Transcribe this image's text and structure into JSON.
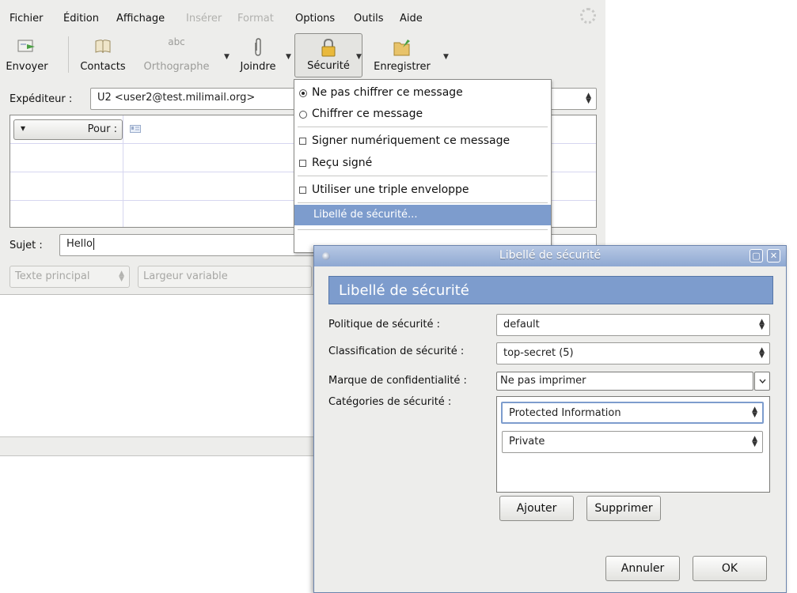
{
  "menubar": {
    "items": [
      {
        "label": "Fichier",
        "disabled": false
      },
      {
        "label": "Édition",
        "disabled": false
      },
      {
        "label": "Affichage",
        "disabled": false
      },
      {
        "label": "Insérer",
        "disabled": true
      },
      {
        "label": "Format",
        "disabled": true
      },
      {
        "label": "Options",
        "disabled": false
      },
      {
        "label": "Outils",
        "disabled": false
      },
      {
        "label": "Aide",
        "disabled": false
      }
    ]
  },
  "toolbar": {
    "send": "Envoyer",
    "contacts": "Contacts",
    "spelling": "Orthographe",
    "spelling_icon_text": "abc",
    "attach": "Joindre",
    "security": "Sécurité",
    "save": "Enregistrer"
  },
  "compose": {
    "sender_label": "Expéditeur :",
    "sender_value": "U2 <user2@test.milimail.org>",
    "to_label": "Pour :",
    "subject_label": "Sujet :",
    "subject_value": "Hello",
    "format_select": "Texte principal",
    "width_select": "Largeur variable"
  },
  "security_menu": {
    "items": [
      {
        "type": "radio",
        "checked": true,
        "label": "Ne pas chiffrer ce message"
      },
      {
        "type": "radio",
        "checked": false,
        "label": "Chiffrer ce message"
      },
      {
        "type": "check",
        "checked": false,
        "label": "Signer numériquement ce message"
      },
      {
        "type": "check",
        "checked": false,
        "label": "Reçu signé"
      },
      {
        "type": "check",
        "checked": false,
        "label": "Utiliser une triple enveloppe"
      },
      {
        "type": "plain",
        "label": "Libellé de sécurité..."
      }
    ],
    "highlighted_index": 5
  },
  "dialog": {
    "title": "Libellé de sécurité",
    "header": "Libellé de sécurité",
    "policy_label": "Politique de sécurité :",
    "policy_value": "default",
    "classification_label": "Classification de sécurité :",
    "classification_value": "top-secret (5)",
    "privacy_label": "Marque de confidentialité :",
    "privacy_value": "Ne pas imprimer",
    "categories_label": "Catégories de sécurité :",
    "categories": [
      "Protected Information",
      "Private"
    ],
    "add_button": "Ajouter",
    "remove_button": "Supprimer",
    "cancel_button": "Annuler",
    "ok_button": "OK"
  },
  "colors": {
    "accent": "#7d9ccd",
    "titlebar": "#8ea8d2",
    "chrome": "#ededeb"
  }
}
